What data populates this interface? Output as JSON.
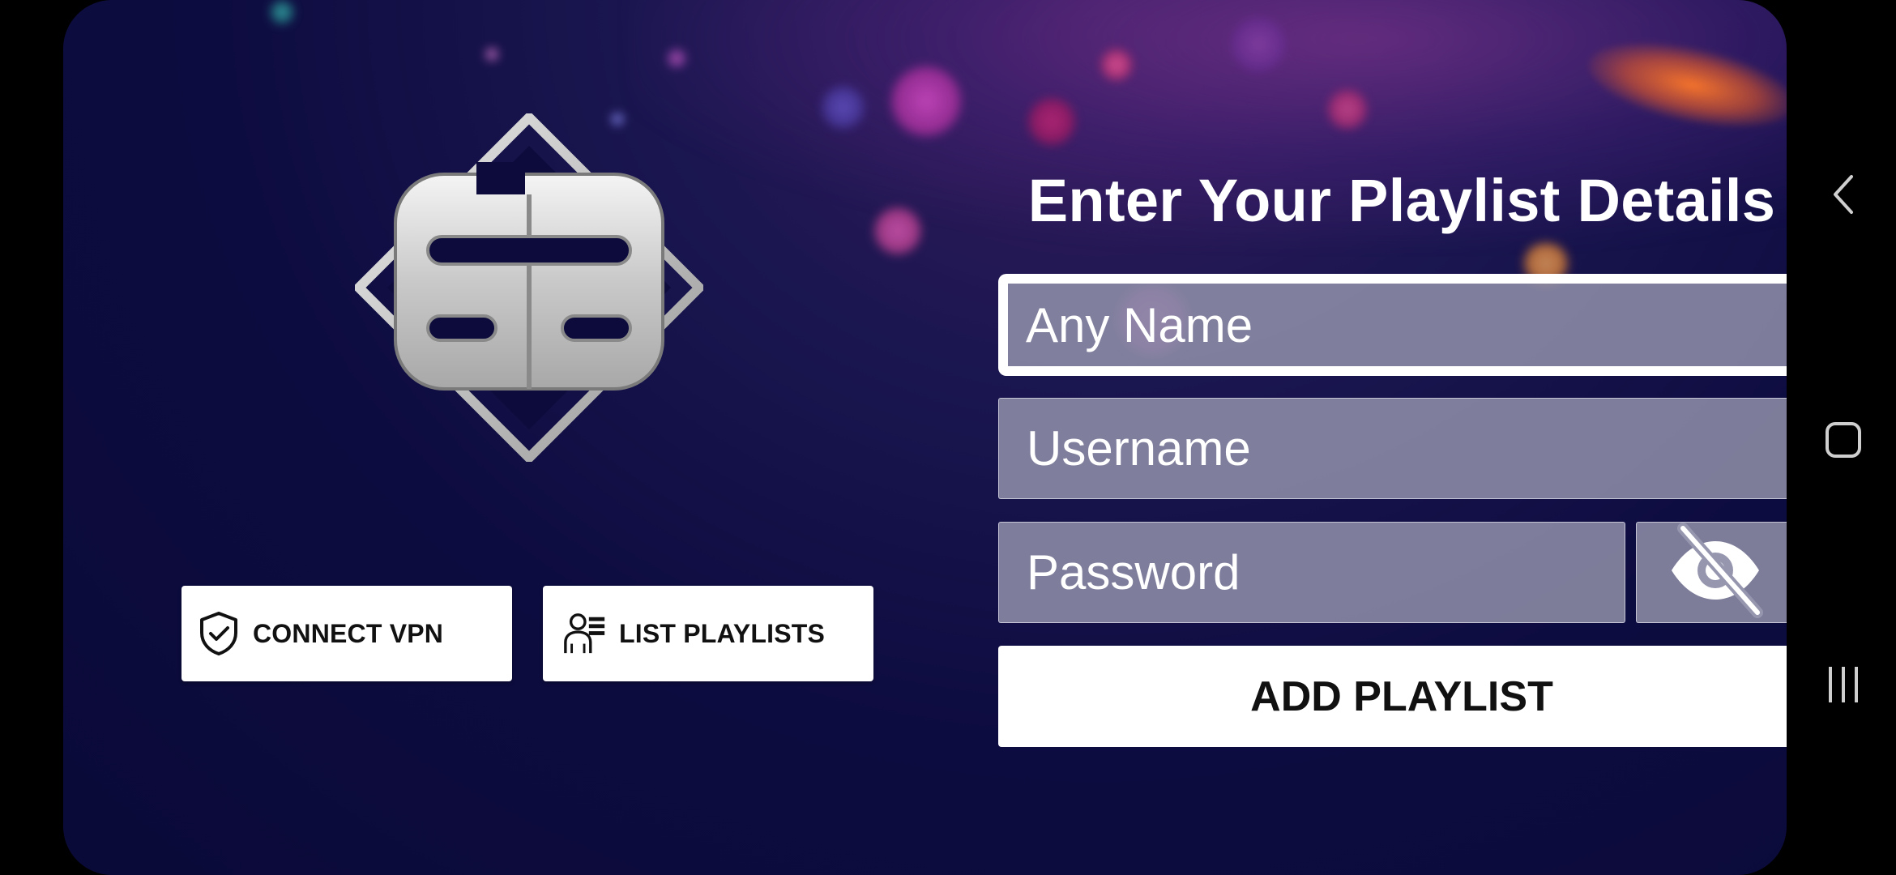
{
  "form": {
    "title": "Enter Your Playlist Details",
    "name_placeholder": "Any Name",
    "name_value": "",
    "username_placeholder": "Username",
    "username_value": "",
    "password_placeholder": "Password",
    "password_value": "",
    "password_visibility_icon": "eye-off-icon",
    "add_label": "ADD PLAYLIST"
  },
  "actions": {
    "vpn_label": "CONNECT VPN",
    "vpn_icon": "shield-check-icon",
    "list_label": "LIST PLAYLISTS",
    "list_icon": "user-list-icon"
  },
  "logo": {
    "name": "app-logo"
  },
  "navbar": {
    "items": [
      "back-icon",
      "home-icon",
      "recents-icon"
    ]
  },
  "colors": {
    "background": "#0d0c40",
    "field_fill": "#9696af",
    "button_fill": "#ffffff",
    "accent_glow": "#ff7828"
  }
}
